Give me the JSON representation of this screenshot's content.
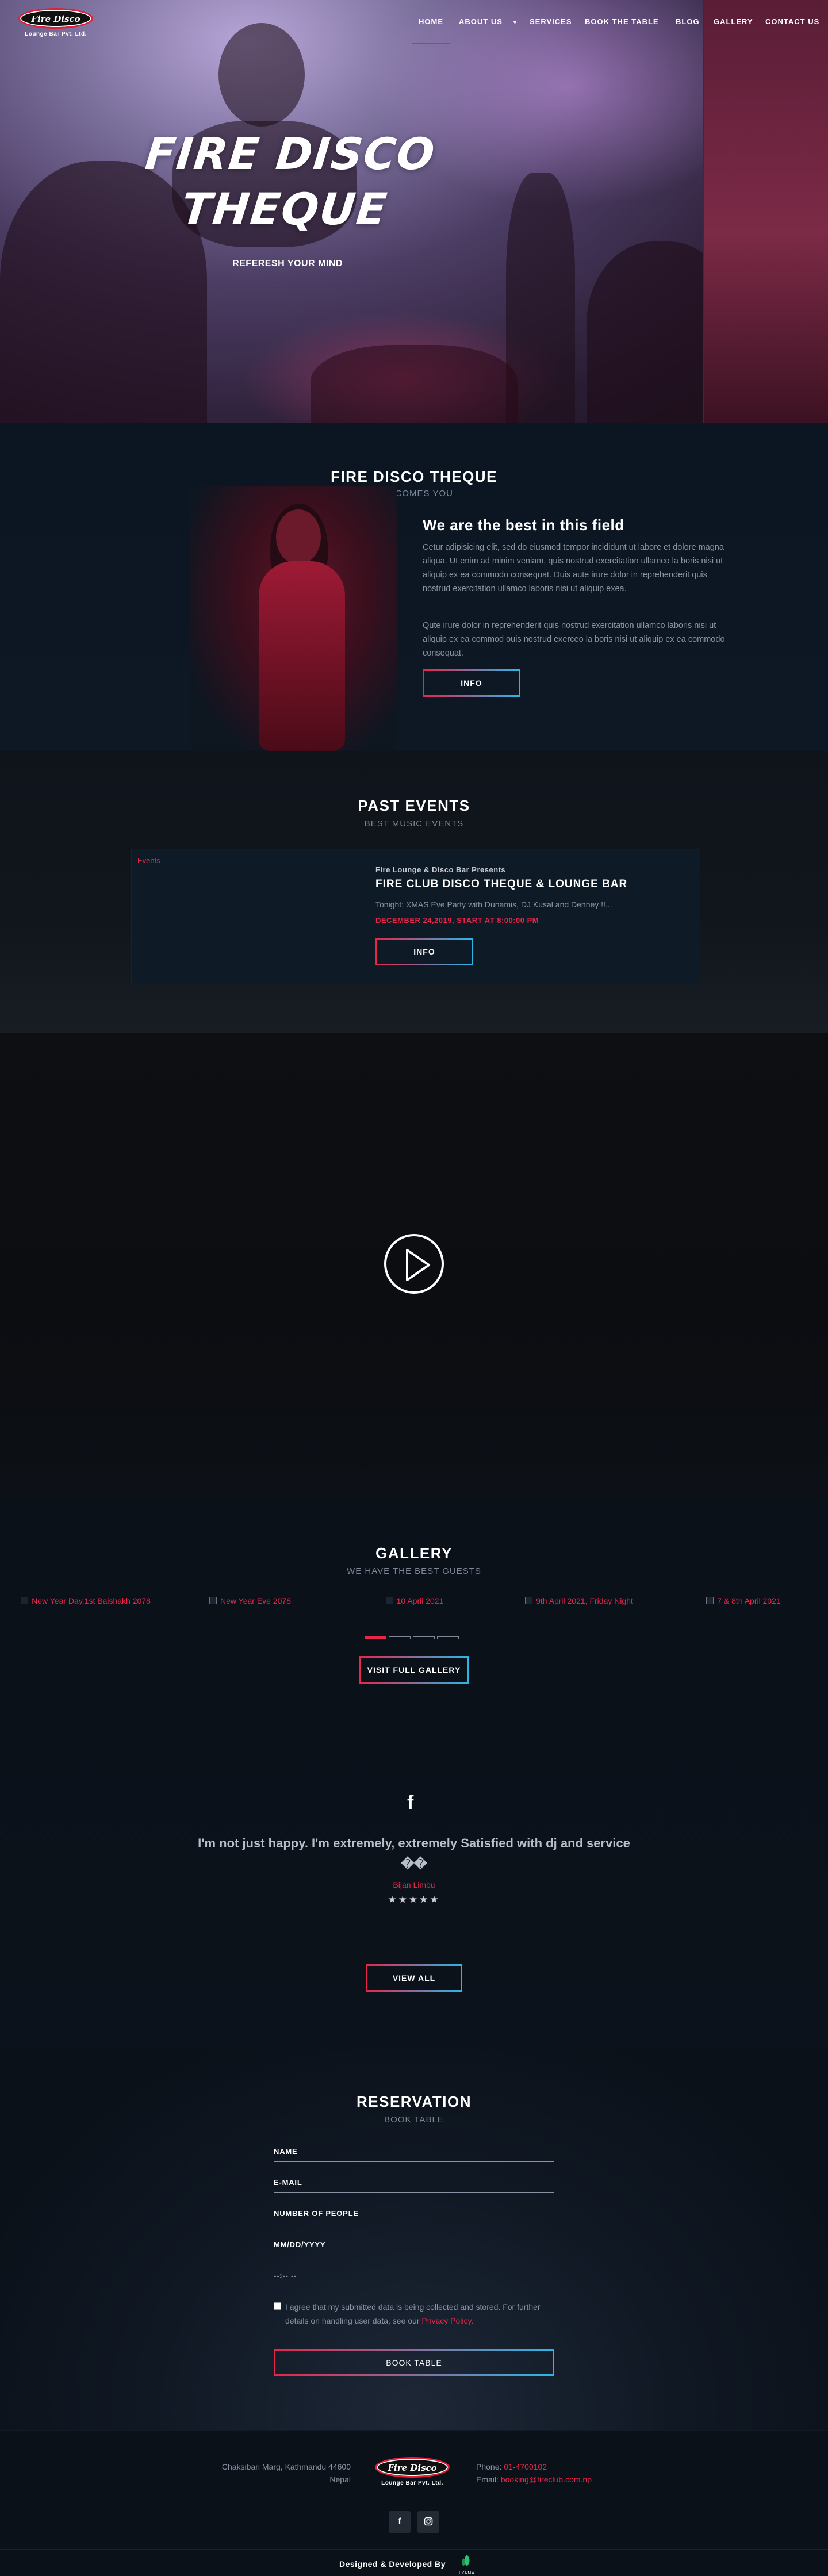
{
  "nav": {
    "logo_text": "Fire Disco",
    "logo_sub": "Lounge Bar Pvt. Ltd.",
    "items": [
      "HOME",
      "ABOUT US",
      "SERVICES",
      "BOOK THE TABLE",
      "BLOG",
      "GALLERY",
      "CONTACT US"
    ],
    "active": "HOME"
  },
  "hero": {
    "title_line1": "FIRE DISCO",
    "title_line2": "THEQUE",
    "subtitle": "REFERESH YOUR MIND"
  },
  "about": {
    "title": "FIRE DISCO THEQUE",
    "subtitle": "WELCOMES YOU",
    "heading": "We are the best in this field",
    "para1": "Cetur adipisicing elit, sed do eiusmod tempor incididunt ut labore et dolore magna aliqua. Ut enim ad minim veniam, quis nostrud exercitation ullamco la boris nisi ut aliquip ex ea commodo consequat. Duis aute irure dolor in reprehenderit quis nostrud exercitation ullamco laboris nisi ut aliquip exea.",
    "para2": "Qute irure dolor in reprehenderit quis nostrud exercitation ullamco laboris nisi ut aliquip ex ea commod ouis nostrud exerceo la boris nisi ut aliquip ex ea commodo consequat.",
    "button": "INFO"
  },
  "events": {
    "title": "PAST EVENTS",
    "subtitle": "BEST MUSIC EVENTS",
    "image_alt": "Events",
    "organizer": "Fire Lounge & Disco Bar Presents",
    "name": "FIRE CLUB DISCO THEQUE & LOUNGE BAR",
    "description": "Tonight: XMAS Eve Party with Dunamis, DJ Kusal and Denney !!...",
    "date": "DECEMBER 24,2019, START AT 8:00:00 PM",
    "button": "INFO"
  },
  "gallery": {
    "title": "GALLERY",
    "subtitle": "WE HAVE THE BEST GUESTS",
    "items": [
      "New Year Day,1st Baishakh 2078",
      "New Year Eve 2078",
      "10 April 2021",
      "9th April 2021, Friday Night",
      "7 & 8th April 2021"
    ],
    "button": "VISIT FULL GALLERY"
  },
  "testimonial": {
    "quote": "I'm not just happy. I'm extremely, extremely Satisfied with dj and service ��",
    "author": "Bijan Limbu",
    "stars": "★★★★★",
    "button": "VIEW ALL"
  },
  "reservation": {
    "title": "RESERVATION",
    "subtitle": "BOOK TABLE",
    "fields": [
      "NAME",
      "E-MAIL",
      "NUMBER OF PEOPLE",
      "MM/DD/YYYY",
      "--:-- --"
    ],
    "consent_text": "I agree that my submitted data is being collected and stored. For further details on handling user data, see our",
    "consent_link": "Privacy Policy.",
    "button": "BOOK TABLE"
  },
  "footer": {
    "address_line1": "Chaksibari Marg, Kathmandu 44600",
    "address_line2": "Nepal",
    "phone_label": "Phone:",
    "phone": "01-4700102",
    "email_label": "Email:",
    "email": "booking@fireclub.com.np",
    "credit": "Designed & Developed By",
    "dev_logo_text": "LYAMA"
  },
  "colors": {
    "accent": "#e8264a",
    "accent2": "#2bb6e8",
    "bg": "#0b1119"
  }
}
